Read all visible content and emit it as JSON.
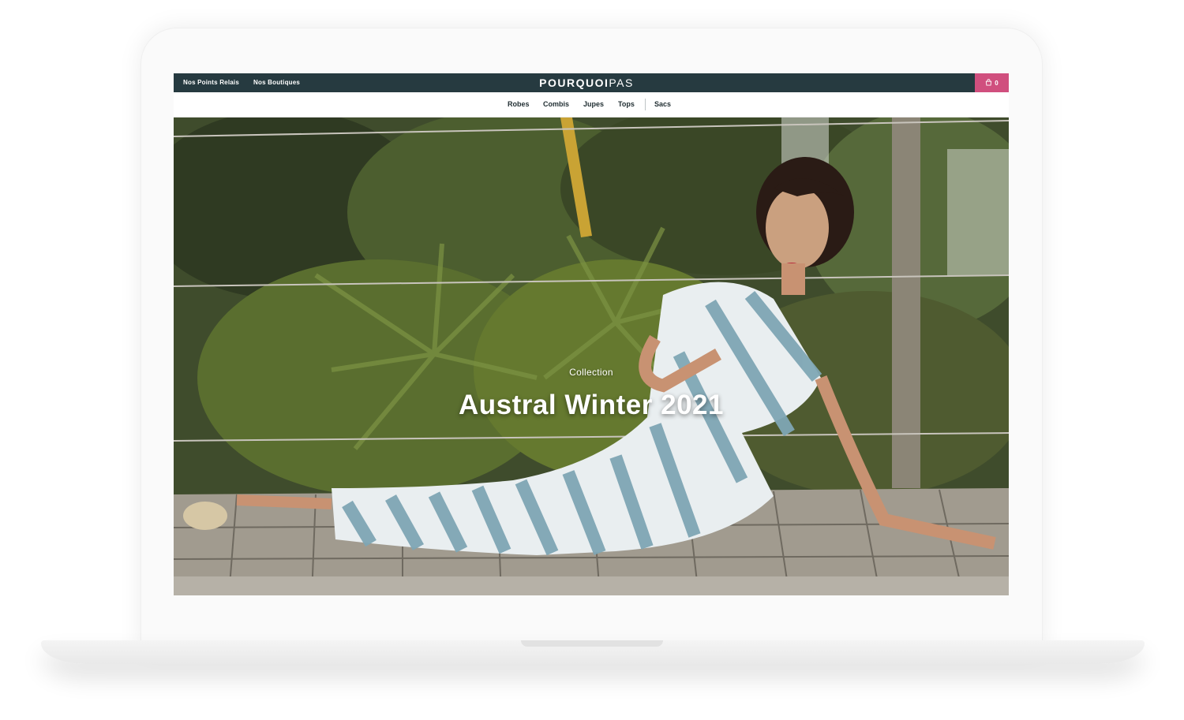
{
  "topbar": {
    "links": [
      "Nos Points Relais",
      "Nos Boutiques"
    ],
    "brand_bold": "POURQUOI",
    "brand_light": "PAS",
    "cart_count": "0",
    "cart_icon": "shopping-bag-icon",
    "accent_color": "#d04f7e",
    "bar_color": "#263a40"
  },
  "nav": {
    "items": [
      "Robes",
      "Combis",
      "Jupes",
      "Tops",
      "Sacs"
    ]
  },
  "hero": {
    "subtitle": "Collection",
    "title": "Austral Winter 2021"
  }
}
